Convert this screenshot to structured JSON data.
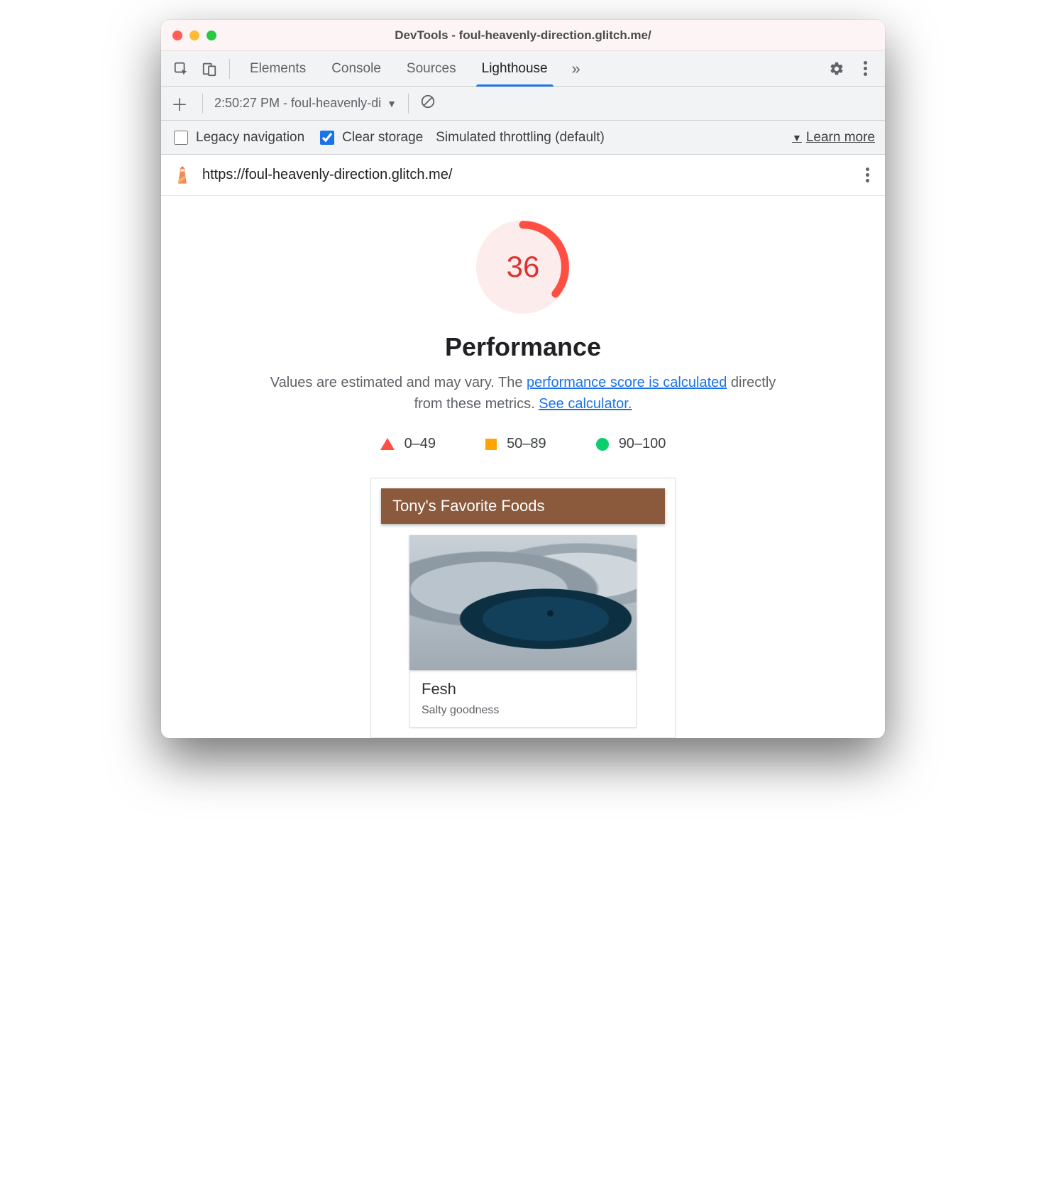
{
  "window": {
    "title": "DevTools - foul-heavenly-direction.glitch.me/"
  },
  "tabs": {
    "items": [
      "Elements",
      "Console",
      "Sources",
      "Lighthouse"
    ],
    "active_index": 3
  },
  "subtoolbar": {
    "report_label": "2:50:27 PM - foul-heavenly-di"
  },
  "options": {
    "legacy_label": "Legacy navigation",
    "legacy_checked": false,
    "clear_label": "Clear storage",
    "clear_checked": true,
    "throttling_label": "Simulated throttling (default)",
    "learn_more": "Learn more"
  },
  "url": "https://foul-heavenly-direction.glitch.me/",
  "report": {
    "score": "36",
    "score_color": "#e03131",
    "heading": "Performance",
    "description_pre": "Values are estimated and may vary. The ",
    "description_link1": "performance score is calculated",
    "description_mid": " directly from these metrics. ",
    "description_link2": "See calculator.",
    "legend": {
      "fail": "0–49",
      "average": "50–89",
      "pass": "90–100"
    }
  },
  "preview": {
    "header": "Tony's Favorite Foods",
    "card_title": "Fesh",
    "card_subtitle": "Salty goodness"
  }
}
